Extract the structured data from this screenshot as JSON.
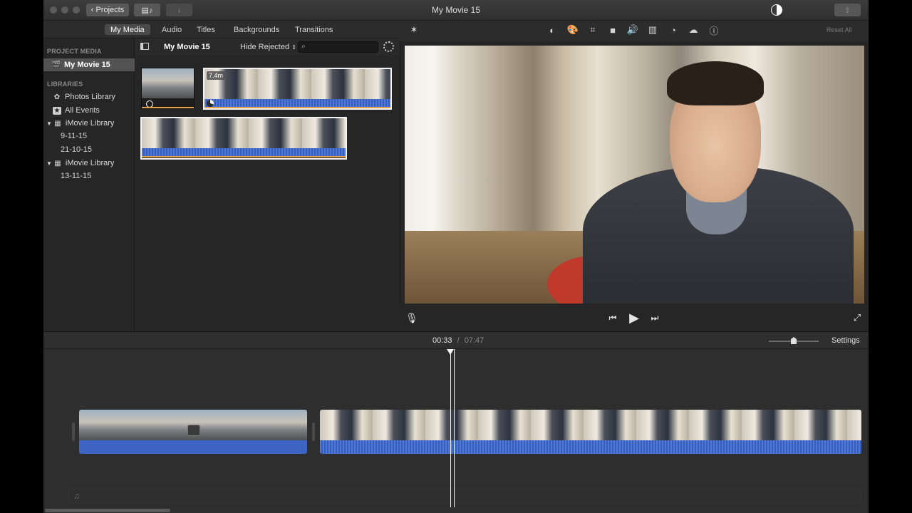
{
  "window": {
    "title": "My Movie 15"
  },
  "titlebar": {
    "projects_label": "Projects"
  },
  "media_tabs": [
    "My Media",
    "Audio",
    "Titles",
    "Backgrounds",
    "Transitions"
  ],
  "libraries": {
    "project_media_header": "PROJECT MEDIA",
    "project_item": "My Movie 15",
    "libraries_header": "LIBRARIES",
    "items": [
      {
        "label": "Photos Library",
        "icon": "flower-icon"
      },
      {
        "label": "All Events",
        "icon": "star-icon"
      }
    ],
    "library1": {
      "label": "iMovie Library",
      "events": [
        "9-11-15",
        "21-10-15"
      ]
    },
    "library2": {
      "label": "iMovie Library",
      "events": [
        "13-11-15"
      ]
    }
  },
  "media_browser": {
    "title": "My Movie 15",
    "filter": "Hide Rejected",
    "search_placeholder": "",
    "clips": [
      {
        "kind": "street",
        "duration": ""
      },
      {
        "kind": "person",
        "duration": "7.4m"
      },
      {
        "kind": "person",
        "duration": ""
      }
    ]
  },
  "viewer": {
    "reset_label": "Reset All",
    "tool_icons": [
      "color-balance-icon",
      "color-correction-icon",
      "crop-icon",
      "stabilization-icon",
      "volume-icon",
      "equalizer-icon",
      "speed-icon",
      "noise-reduction-icon",
      "clip-filter-icon",
      "info-icon"
    ]
  },
  "timeline": {
    "current_time": "00:33",
    "separator": "/",
    "total_time": "07:47",
    "settings_label": "Settings",
    "zoom_level": 0.45,
    "playhead_fraction": 0.49
  },
  "colors": {
    "audio_blue": "#3d63c4",
    "selection_orange": "#e8a24a",
    "panel_bg": "#262626"
  }
}
